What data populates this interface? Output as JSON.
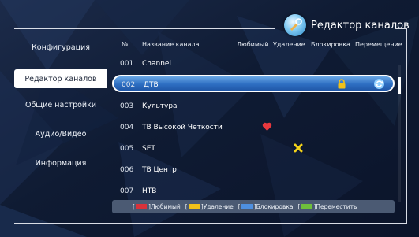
{
  "title": "Редактор каналов",
  "sidebar": {
    "items": [
      {
        "label": "Конфигурация",
        "active": false
      },
      {
        "label": "Редактор каналов",
        "active": true
      },
      {
        "label": "Общие настройки",
        "active": false
      },
      {
        "label": "Аудио/Видео",
        "active": false
      },
      {
        "label": "Информация",
        "active": false
      }
    ]
  },
  "table": {
    "headers": {
      "num": "№",
      "name": "Название канала",
      "fav": "Любимый",
      "delete": "Удаление",
      "lock": "Блокировка",
      "move": "Перемещение"
    },
    "rows": [
      {
        "num": "001",
        "name": "Channel",
        "icon": ""
      },
      {
        "num": "002",
        "name": "ДТВ",
        "icon": "lock+move",
        "selected": true
      },
      {
        "num": "003",
        "name": "Культура",
        "icon": ""
      },
      {
        "num": "004",
        "name": "ТВ Высокой Четкости",
        "icon": "favorite-heart"
      },
      {
        "num": "005",
        "name": "SET",
        "icon": "delete-x"
      },
      {
        "num": "006",
        "name": "ТВ Центр",
        "icon": ""
      },
      {
        "num": "007",
        "name": "НТВ",
        "icon": ""
      }
    ]
  },
  "legend": [
    {
      "label": "]Любимый",
      "color": "#d8323a"
    },
    {
      "label": "]Удаление",
      "color": "#f1c11a"
    },
    {
      "label": "]Блокировка",
      "color": "#4e8fdf"
    },
    {
      "label": "]Переместить",
      "color": "#6fbf3c"
    }
  ],
  "legend_brackets": [
    "[",
    "[",
    "[",
    "["
  ],
  "colors": {
    "background": "#0f1b33",
    "highlight": "#2e6fc2",
    "favorite": "#e8383e",
    "delete": "#f3d21a"
  }
}
